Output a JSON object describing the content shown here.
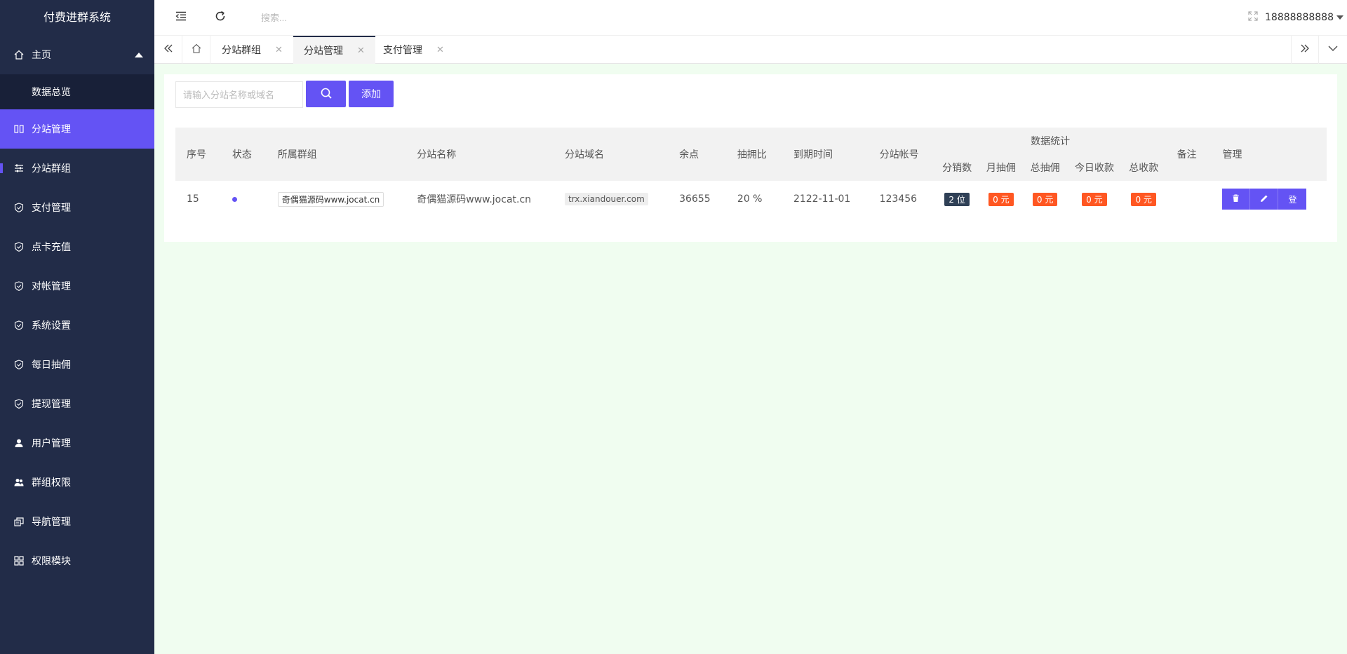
{
  "app": {
    "title": "付费进群系统"
  },
  "sidebar": {
    "home": {
      "label": "主页",
      "icon": "home-icon"
    },
    "home_sub": "数据总览",
    "items": [
      {
        "key": "substation",
        "label": "分站管理",
        "icon": "columns-icon"
      },
      {
        "key": "group",
        "label": "分站群组",
        "icon": "sliders-icon"
      },
      {
        "key": "pay",
        "label": "支付管理",
        "icon": "shield-check-icon"
      },
      {
        "key": "card",
        "label": "点卡充值",
        "icon": "shield-check-icon"
      },
      {
        "key": "recon",
        "label": "对帐管理",
        "icon": "shield-check-icon"
      },
      {
        "key": "settings",
        "label": "系统设置",
        "icon": "shield-check-icon"
      },
      {
        "key": "commission",
        "label": "每日抽佣",
        "icon": "shield-check-icon"
      },
      {
        "key": "withdraw",
        "label": "提现管理",
        "icon": "shield-check-icon"
      },
      {
        "key": "users",
        "label": "用户管理",
        "icon": "user-icon"
      },
      {
        "key": "perm",
        "label": "群组权限",
        "icon": "users-icon"
      },
      {
        "key": "navmgr",
        "label": "导航管理",
        "icon": "nav-icon"
      },
      {
        "key": "modules",
        "label": "权限模块",
        "icon": "grid-icon"
      }
    ]
  },
  "header": {
    "search_placeholder": "搜索...",
    "user": "18888888888"
  },
  "tabs": [
    {
      "label": "分站群组"
    },
    {
      "label": "分站管理"
    },
    {
      "label": "支付管理"
    }
  ],
  "main": {
    "search_placeholder": "请输入分站名称或域名",
    "add_label": "添加",
    "columns": {
      "index": "序号",
      "status": "状态",
      "group": "所属群组",
      "name": "分站名称",
      "domain": "分站域名",
      "points": "余点",
      "rate": "抽拥比",
      "expire": "到期时间",
      "account": "分站帐号",
      "stats": "数据统计",
      "sub_count": "分销数",
      "month_comm": "月抽佣",
      "total_comm": "总抽佣",
      "today_income": "今日收款",
      "total_income": "总收款",
      "remark": "备注",
      "manage": "管理"
    },
    "rows": [
      {
        "index": "15",
        "group": "奇偶猫源码www.jocat.cn",
        "name": "奇偶猫源码www.jocat.cn",
        "domain": "trx.xiandouer.com",
        "points": "36655",
        "rate": "20 %",
        "expire": "2122-11-01",
        "account": "123456",
        "sub_count": "2 位",
        "month_comm": "0 元",
        "total_comm": "0 元",
        "today_income": "0 元",
        "total_income": "0 元",
        "remark": "",
        "login_label": "登"
      }
    ]
  },
  "colors": {
    "primary": "#6453f4",
    "sidebar": "#222c48",
    "badge_red": "#ff5722",
    "badge_dark": "#2f4056"
  }
}
